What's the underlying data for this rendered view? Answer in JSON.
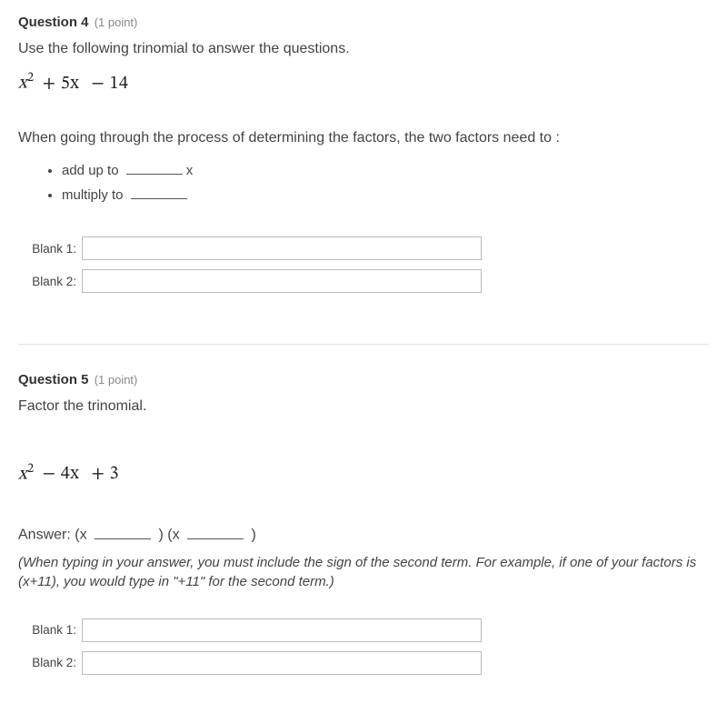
{
  "q4": {
    "label": "Question 4",
    "points": "(1 point)",
    "prompt": "Use the following trinomial to answer the questions.",
    "trinomial": {
      "a": "x",
      "exp": "2",
      "b": "+ 5x",
      "c": "− 14"
    },
    "sub_prompt": "When going through the process of determining the factors, the two factors need to :",
    "bullets": {
      "b1_pre": "add up to ",
      "b1_post": "x",
      "b2_pre": "multiply to "
    },
    "blanks": {
      "b1_label": "Blank 1:",
      "b1_value": "",
      "b2_label": "Blank 2:",
      "b2_value": ""
    }
  },
  "q5": {
    "label": "Question 5",
    "points": "(1 point)",
    "prompt": "Factor the trinomial.",
    "trinomial": {
      "a": "x",
      "exp": "2",
      "b": "− 4x",
      "c": "+ 3"
    },
    "answer_template": {
      "pre1": "Answer: (x ",
      "mid": " ) (x ",
      "post": " )"
    },
    "instruction": "(When typing in your answer, you must include the sign of the second term.  For example, if one of your factors is (x+11), you would type in \"+11\"  for the second term.)",
    "blanks": {
      "b1_label": "Blank 1:",
      "b1_value": "",
      "b2_label": "Blank 2:",
      "b2_value": ""
    }
  }
}
